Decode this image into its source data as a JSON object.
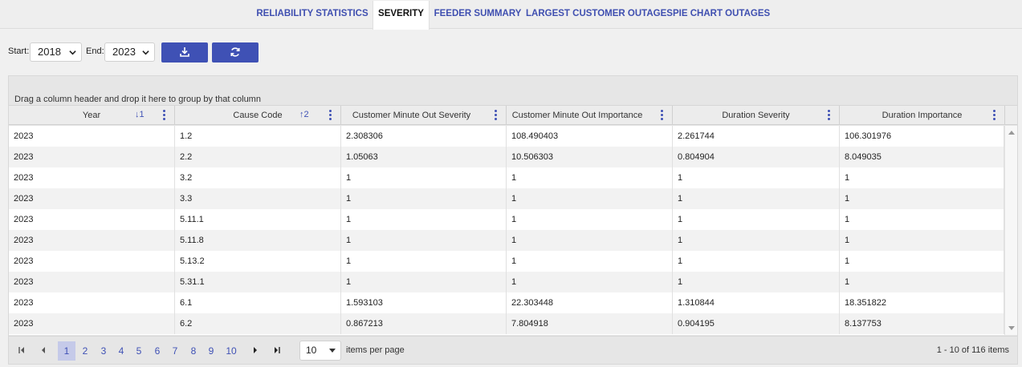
{
  "tabs": [
    {
      "label": "RELIABILITY STATISTICS",
      "active": false
    },
    {
      "label": "SEVERITY",
      "active": true
    },
    {
      "label": "FEEDER SUMMARY",
      "active": false
    },
    {
      "label": "LARGEST CUSTOMER OUTAGES",
      "active": false
    },
    {
      "label": "PIE CHART OUTAGES",
      "active": false
    }
  ],
  "toolbar": {
    "start_label": "Start:",
    "start_value": "2018",
    "end_label": "End:",
    "end_value": "2023",
    "download_icon": "download-icon",
    "refresh_icon": "refresh-icon",
    "button_color": "#3f51b5"
  },
  "grid": {
    "group_hint": "Drag a column header and drop it here to group by that column",
    "columns": [
      {
        "title": "Year",
        "sort": "↓1"
      },
      {
        "title": "Cause Code",
        "sort": "↑2"
      },
      {
        "title": "Customer Minute Out Severity",
        "sort": ""
      },
      {
        "title": "Customer Minute Out Importance",
        "sort": ""
      },
      {
        "title": "Duration Severity",
        "sort": ""
      },
      {
        "title": "Duration Importance",
        "sort": ""
      }
    ],
    "rows": [
      [
        "2023",
        "1.2",
        "2.308306",
        "108.490403",
        "2.261744",
        "106.301976"
      ],
      [
        "2023",
        "2.2",
        "1.05063",
        "10.506303",
        "0.804904",
        "8.049035"
      ],
      [
        "2023",
        "3.2",
        "1",
        "1",
        "1",
        "1"
      ],
      [
        "2023",
        "3.3",
        "1",
        "1",
        "1",
        "1"
      ],
      [
        "2023",
        "5.11.1",
        "1",
        "1",
        "1",
        "1"
      ],
      [
        "2023",
        "5.11.8",
        "1",
        "1",
        "1",
        "1"
      ],
      [
        "2023",
        "5.13.2",
        "1",
        "1",
        "1",
        "1"
      ],
      [
        "2023",
        "5.31.1",
        "1",
        "1",
        "1",
        "1"
      ],
      [
        "2023",
        "6.1",
        "1.593103",
        "22.303448",
        "1.310844",
        "18.351822"
      ],
      [
        "2023",
        "6.2",
        "0.867213",
        "7.804918",
        "0.904195",
        "8.137753"
      ]
    ]
  },
  "pager": {
    "pages": [
      "1",
      "2",
      "3",
      "4",
      "5",
      "6",
      "7",
      "8",
      "9",
      "10"
    ],
    "current_page": "1",
    "page_size": "10",
    "items_per_page_label": "items per page",
    "info": "1 - 10 of 116 items"
  }
}
